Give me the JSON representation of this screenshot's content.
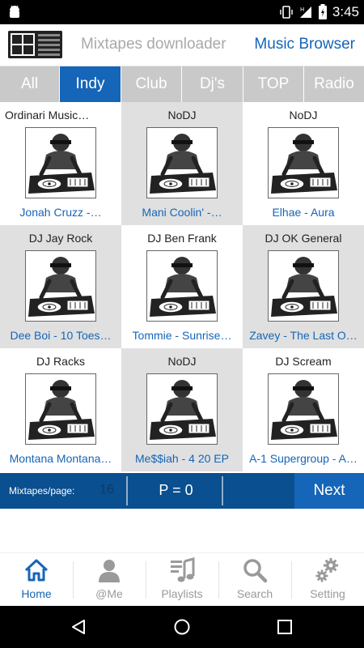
{
  "status_bar": {
    "time": "3:45"
  },
  "app_bar": {
    "subtitle": "Mixtapes downloader",
    "browser_link": "Music Browser"
  },
  "tabs": [
    {
      "label": "All",
      "active": false
    },
    {
      "label": "Indy",
      "active": true
    },
    {
      "label": "Club",
      "active": false
    },
    {
      "label": "Dj's",
      "active": false
    },
    {
      "label": "TOP",
      "active": false
    },
    {
      "label": "Radio",
      "active": false
    }
  ],
  "mixtapes": [
    {
      "dj": "Ordinari Music…",
      "title": "Jonah Cruzz -…"
    },
    {
      "dj": "NoDJ",
      "title": "Mani Coolin' -…"
    },
    {
      "dj": "NoDJ",
      "title": "Elhae - Aura"
    },
    {
      "dj": "DJ Jay Rock",
      "title": "Dee Boi - 10 Toes…"
    },
    {
      "dj": "DJ Ben Frank",
      "title": "Tommie - Sunrise…"
    },
    {
      "dj": "DJ OK General",
      "title": "Zavey - The Last O…"
    },
    {
      "dj": "DJ Racks",
      "title": "Montana Montana…"
    },
    {
      "dj": "NoDJ",
      "title": "Me$$iah - 4 20 EP"
    },
    {
      "dj": "DJ Scream",
      "title": "A-1 Supergroup - A…"
    }
  ],
  "pager": {
    "per_page_label": "Mixtapes/page:",
    "per_page_value": "16",
    "page_text": "P = 0",
    "next_label": "Next"
  },
  "bottom_nav": [
    {
      "label": "Home",
      "icon": "home-icon",
      "active": true
    },
    {
      "label": "@Me",
      "icon": "user-icon",
      "active": false
    },
    {
      "label": "Playlists",
      "icon": "playlist-icon",
      "active": false
    },
    {
      "label": "Search",
      "icon": "search-icon",
      "active": false
    },
    {
      "label": "Setting",
      "icon": "gear-icon",
      "active": false
    }
  ],
  "colors": {
    "accent": "#1565b8",
    "tab_inactive": "#c9c9c9",
    "pager_bar": "#0a4f8f",
    "cell_shaded": "#e0e0e0"
  }
}
